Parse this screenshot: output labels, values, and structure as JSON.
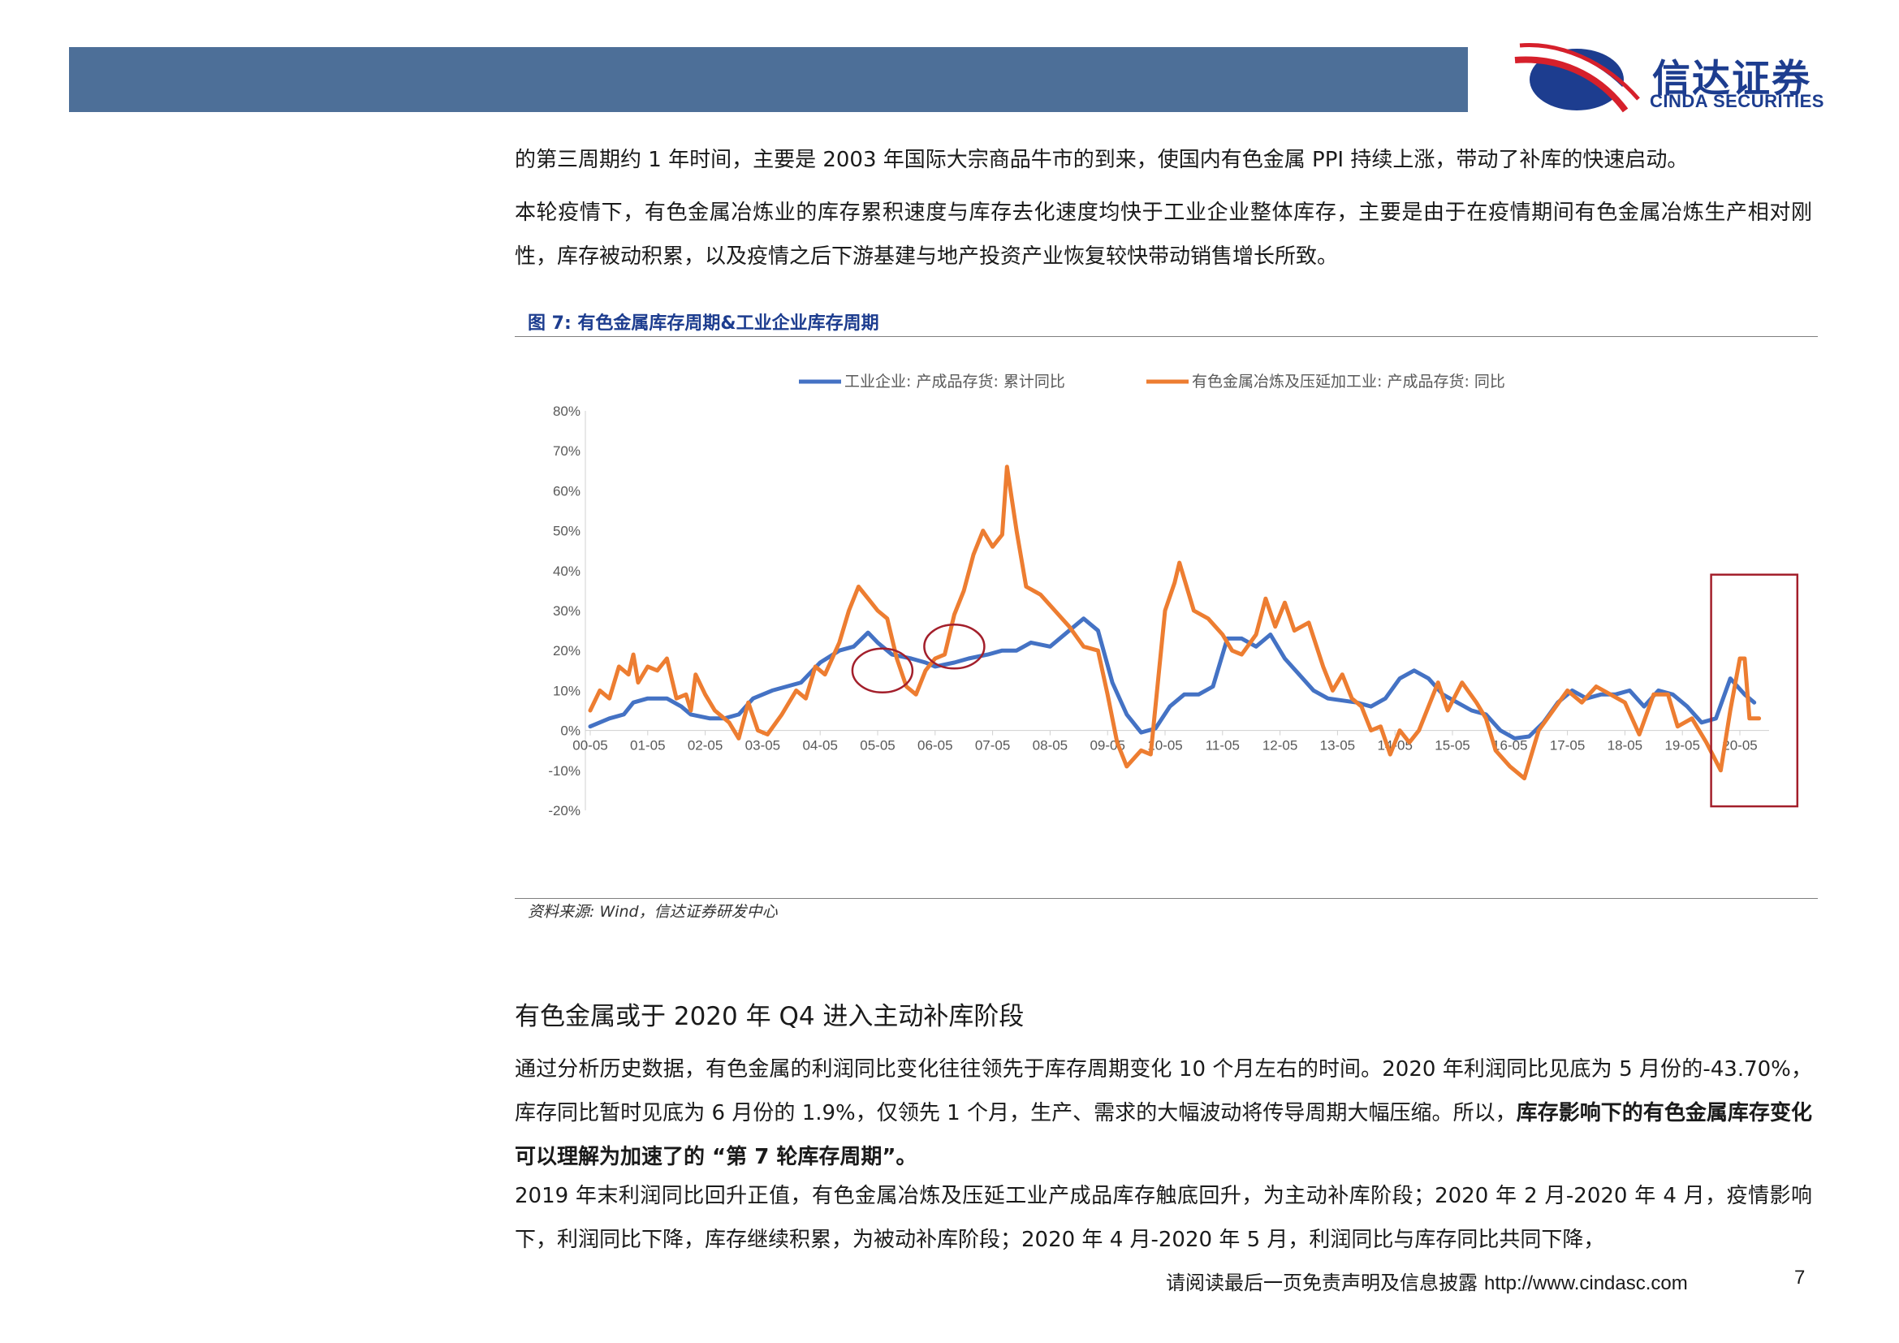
{
  "header": {
    "logo_cn": "信达证券",
    "logo_en": "CINDA SECURITIES",
    "brand_color": "#1d3d8f",
    "bar_color": "#4d6f98"
  },
  "body": {
    "para1": "的第三周期约 1 年时间，主要是 2003 年国际大宗商品牛市的到来，使国内有色金属 PPI 持续上涨，带动了补库的快速启动。",
    "para2": "本轮疫情下，有色金属冶炼业的库存累积速度与库存去化速度均快于工业企业整体库存，主要是由于在疫情期间有色金属冶炼生产相对刚性，库存被动积累，以及疫情之后下游基建与地产投资产业恢复较快带动销售增长所致。"
  },
  "figure": {
    "title": "图 7: 有色金属库存周期&工业企业库存周期",
    "source": "资料来源: Wind，信达证券研发中心"
  },
  "chart_data": {
    "type": "line",
    "legend_position": "top",
    "ylim": [
      -0.2,
      0.8
    ],
    "yticks": [
      "80%",
      "70%",
      "60%",
      "50%",
      "40%",
      "30%",
      "20%",
      "10%",
      "0%",
      "-10%",
      "-20%"
    ],
    "xlabels": [
      "00-05",
      "01-05",
      "02-05",
      "03-05",
      "04-05",
      "05-05",
      "06-05",
      "07-05",
      "08-05",
      "09-05",
      "10-05",
      "11-05",
      "12-05",
      "13-05",
      "14-05",
      "15-05",
      "16-05",
      "17-05",
      "18-05",
      "19-05",
      "20-05"
    ],
    "x_start": "2000-05",
    "series": [
      {
        "name": "工业企业: 产成品存货: 累计同比",
        "color": "#4472c4",
        "points": [
          [
            "2000-05",
            0.01
          ],
          [
            "2000-09",
            0.03
          ],
          [
            "2000-12",
            0.04
          ],
          [
            "2001-02",
            0.07
          ],
          [
            "2001-05",
            0.08
          ],
          [
            "2001-09",
            0.08
          ],
          [
            "2001-12",
            0.06
          ],
          [
            "2002-02",
            0.04
          ],
          [
            "2002-06",
            0.03
          ],
          [
            "2002-09",
            0.03
          ],
          [
            "2002-12",
            0.04
          ],
          [
            "2003-03",
            0.08
          ],
          [
            "2003-07",
            0.1
          ],
          [
            "2003-10",
            0.11
          ],
          [
            "2004-01",
            0.12
          ],
          [
            "2004-05",
            0.17
          ],
          [
            "2004-09",
            0.2
          ],
          [
            "2004-12",
            0.21
          ],
          [
            "2005-03",
            0.245
          ],
          [
            "2005-05",
            0.22
          ],
          [
            "2005-08",
            0.19
          ],
          [
            "2005-12",
            0.18
          ],
          [
            "2006-03",
            0.17
          ],
          [
            "2006-05",
            0.16
          ],
          [
            "2006-09",
            0.17
          ],
          [
            "2006-12",
            0.18
          ],
          [
            "2007-04",
            0.19
          ],
          [
            "2007-07",
            0.2
          ],
          [
            "2007-10",
            0.2
          ],
          [
            "2008-01",
            0.22
          ],
          [
            "2008-05",
            0.21
          ],
          [
            "2008-09",
            0.25
          ],
          [
            "2008-12",
            0.28
          ],
          [
            "2009-03",
            0.25
          ],
          [
            "2009-06",
            0.12
          ],
          [
            "2009-09",
            0.04
          ],
          [
            "2009-12",
            -0.005
          ],
          [
            "2010-03",
            0.005
          ],
          [
            "2010-06",
            0.06
          ],
          [
            "2010-09",
            0.09
          ],
          [
            "2010-12",
            0.09
          ],
          [
            "2011-03",
            0.11
          ],
          [
            "2011-06",
            0.23
          ],
          [
            "2011-09",
            0.23
          ],
          [
            "2011-12",
            0.21
          ],
          [
            "2012-03",
            0.24
          ],
          [
            "2012-06",
            0.18
          ],
          [
            "2012-09",
            0.14
          ],
          [
            "2012-12",
            0.1
          ],
          [
            "2013-03",
            0.08
          ],
          [
            "2013-06",
            0.075
          ],
          [
            "2013-09",
            0.07
          ],
          [
            "2013-12",
            0.06
          ],
          [
            "2014-03",
            0.08
          ],
          [
            "2014-06",
            0.13
          ],
          [
            "2014-09",
            0.15
          ],
          [
            "2014-12",
            0.13
          ],
          [
            "2015-03",
            0.09
          ],
          [
            "2015-06",
            0.07
          ],
          [
            "2015-09",
            0.05
          ],
          [
            "2015-12",
            0.04
          ],
          [
            "2016-03",
            0.0
          ],
          [
            "2016-06",
            -0.02
          ],
          [
            "2016-09",
            -0.015
          ],
          [
            "2016-12",
            0.02
          ],
          [
            "2017-03",
            0.07
          ],
          [
            "2017-06",
            0.1
          ],
          [
            "2017-09",
            0.08
          ],
          [
            "2017-12",
            0.09
          ],
          [
            "2018-03",
            0.09
          ],
          [
            "2018-06",
            0.1
          ],
          [
            "2018-09",
            0.06
          ],
          [
            "2018-12",
            0.1
          ],
          [
            "2019-03",
            0.09
          ],
          [
            "2019-06",
            0.06
          ],
          [
            "2019-09",
            0.02
          ],
          [
            "2019-12",
            0.03
          ],
          [
            "2020-03",
            0.13
          ],
          [
            "2020-06",
            0.09
          ],
          [
            "2020-08",
            0.07
          ]
        ]
      },
      {
        "name": "有色金属冶炼及压延加工业: 产成品存货: 同比",
        "color": "#ed7d31",
        "points": [
          [
            "2000-05",
            0.05
          ],
          [
            "2000-07",
            0.1
          ],
          [
            "2000-09",
            0.08
          ],
          [
            "2000-11",
            0.16
          ],
          [
            "2001-01",
            0.14
          ],
          [
            "2001-02",
            0.19
          ],
          [
            "2001-03",
            0.12
          ],
          [
            "2001-05",
            0.16
          ],
          [
            "2001-07",
            0.15
          ],
          [
            "2001-09",
            0.18
          ],
          [
            "2001-11",
            0.08
          ],
          [
            "2002-01",
            0.09
          ],
          [
            "2002-02",
            0.05
          ],
          [
            "2002-03",
            0.14
          ],
          [
            "2002-05",
            0.09
          ],
          [
            "2002-07",
            0.05
          ],
          [
            "2002-10",
            0.02
          ],
          [
            "2002-12",
            -0.02
          ],
          [
            "2003-02",
            0.07
          ],
          [
            "2003-04",
            0.0
          ],
          [
            "2003-06",
            -0.01
          ],
          [
            "2003-09",
            0.04
          ],
          [
            "2003-12",
            0.1
          ],
          [
            "2004-02",
            0.08
          ],
          [
            "2004-04",
            0.16
          ],
          [
            "2004-06",
            0.14
          ],
          [
            "2004-09",
            0.22
          ],
          [
            "2004-11",
            0.3
          ],
          [
            "2005-01",
            0.36
          ],
          [
            "2005-03",
            0.33
          ],
          [
            "2005-05",
            0.3
          ],
          [
            "2005-07",
            0.28
          ],
          [
            "2005-09",
            0.18
          ],
          [
            "2005-11",
            0.11
          ],
          [
            "2006-01",
            0.09
          ],
          [
            "2006-03",
            0.15
          ],
          [
            "2006-05",
            0.18
          ],
          [
            "2006-07",
            0.19
          ],
          [
            "2006-09",
            0.29
          ],
          [
            "2006-11",
            0.35
          ],
          [
            "2007-01",
            0.44
          ],
          [
            "2007-03",
            0.5
          ],
          [
            "2007-05",
            0.46
          ],
          [
            "2007-07",
            0.49
          ],
          [
            "2007-08",
            0.66
          ],
          [
            "2007-10",
            0.5
          ],
          [
            "2007-12",
            0.36
          ],
          [
            "2008-03",
            0.34
          ],
          [
            "2008-06",
            0.3
          ],
          [
            "2008-09",
            0.26
          ],
          [
            "2008-12",
            0.21
          ],
          [
            "2009-03",
            0.2
          ],
          [
            "2009-05",
            0.09
          ],
          [
            "2009-07",
            -0.03
          ],
          [
            "2009-09",
            -0.09
          ],
          [
            "2009-12",
            -0.05
          ],
          [
            "2010-02",
            -0.06
          ],
          [
            "2010-05",
            0.3
          ],
          [
            "2010-07",
            0.37
          ],
          [
            "2010-08",
            0.42
          ],
          [
            "2010-11",
            0.3
          ],
          [
            "2011-02",
            0.28
          ],
          [
            "2011-05",
            0.24
          ],
          [
            "2011-07",
            0.2
          ],
          [
            "2011-09",
            0.19
          ],
          [
            "2011-12",
            0.24
          ],
          [
            "2012-02",
            0.33
          ],
          [
            "2012-04",
            0.26
          ],
          [
            "2012-06",
            0.32
          ],
          [
            "2012-08",
            0.25
          ],
          [
            "2012-11",
            0.27
          ],
          [
            "2013-02",
            0.16
          ],
          [
            "2013-04",
            0.1
          ],
          [
            "2013-06",
            0.14
          ],
          [
            "2013-08",
            0.08
          ],
          [
            "2013-10",
            0.06
          ],
          [
            "2013-12",
            0.0
          ],
          [
            "2014-02",
            0.01
          ],
          [
            "2014-04",
            -0.06
          ],
          [
            "2014-06",
            0.0
          ],
          [
            "2014-08",
            -0.03
          ],
          [
            "2014-10",
            0.0
          ],
          [
            "2014-12",
            0.06
          ],
          [
            "2015-02",
            0.12
          ],
          [
            "2015-04",
            0.05
          ],
          [
            "2015-07",
            0.12
          ],
          [
            "2015-10",
            0.07
          ],
          [
            "2015-12",
            0.03
          ],
          [
            "2016-02",
            -0.05
          ],
          [
            "2016-05",
            -0.09
          ],
          [
            "2016-08",
            -0.12
          ],
          [
            "2016-11",
            0.0
          ],
          [
            "2017-02",
            0.05
          ],
          [
            "2017-05",
            0.1
          ],
          [
            "2017-08",
            0.07
          ],
          [
            "2017-11",
            0.11
          ],
          [
            "2018-02",
            0.09
          ],
          [
            "2018-05",
            0.07
          ],
          [
            "2018-08",
            -0.01
          ],
          [
            "2018-11",
            0.09
          ],
          [
            "2019-02",
            0.09
          ],
          [
            "2019-04",
            0.01
          ],
          [
            "2019-07",
            0.03
          ],
          [
            "2019-10",
            -0.03
          ],
          [
            "2020-01",
            -0.1
          ],
          [
            "2020-03",
            0.05
          ],
          [
            "2020-05",
            0.18
          ],
          [
            "2020-06",
            0.18
          ],
          [
            "2020-07",
            0.03
          ],
          [
            "2020-09",
            0.03
          ]
        ]
      }
    ],
    "annotations": {
      "circles": [
        [
          "2005-06",
          0.15
        ],
        [
          "2006-09",
          0.21
        ]
      ],
      "highlight_box": {
        "x": [
          "2019-11",
          "2021-05"
        ],
        "y": [
          -0.19,
          0.39
        ]
      }
    }
  },
  "section": {
    "title": "有色金属或于 2020 年 Q4 进入主动补库阶段",
    "para3_normal": "通过分析历史数据，有色金属的利润同比变化往往领先于库存周期变化 10 个月左右的时间。2020 年利润同比见底为 5 月份的-43.70%，库存同比暂时见底为 6 月份的 1.9%，仅领先 1 个月，生产、需求的大幅波动将传导周期大幅压缩。所以，",
    "para3_bold": "库存影响下的有色金属库存变化可以理解为加速了的 “第 7 轮库存周期”。",
    "para4": "2019 年末利润同比回升正值，有色金属冶炼及压延工业产成品库存触底回升，为主动补库阶段；2020 年 2 月-2020 年 4 月，疫情影响下，利润同比下降，库存继续积累，为被动补库阶段；2020 年 4 月-2020 年 5 月，利润同比与库存同比共同下降，"
  },
  "footer": {
    "disclaimer": "请阅读最后一页免责声明及信息披露",
    "url": "http://www.cindasc.com",
    "page": "7"
  }
}
